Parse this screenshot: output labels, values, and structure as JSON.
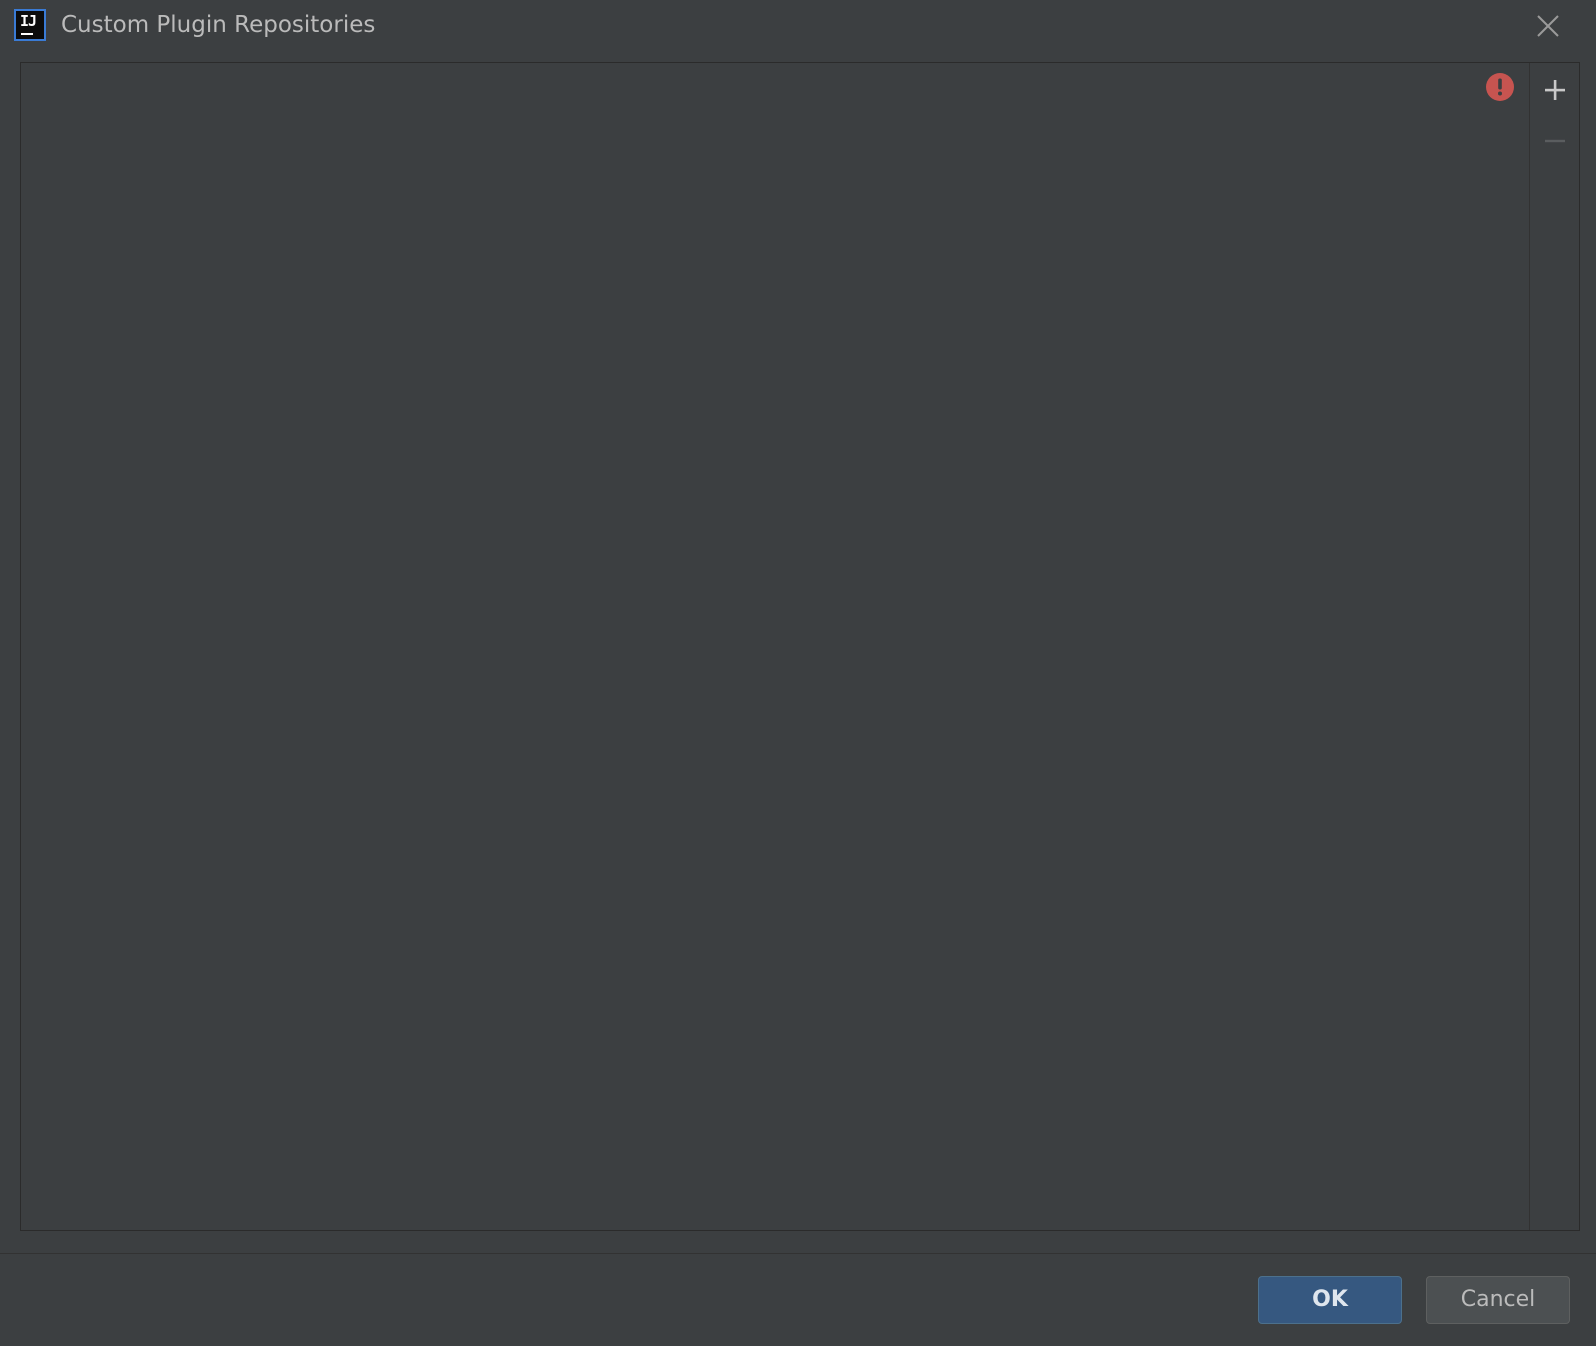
{
  "window": {
    "title": "Custom Plugin Repositories",
    "app_icon_text": "IJ"
  },
  "toolbar": {
    "add_icon": "plus-icon",
    "remove_icon": "minus-icon",
    "status_icon": "error-icon"
  },
  "buttons": {
    "ok_label": "OK",
    "cancel_label": "Cancel"
  },
  "colors": {
    "background": "#3c3f41",
    "primary_button": "#365880",
    "error": "#c75450"
  }
}
